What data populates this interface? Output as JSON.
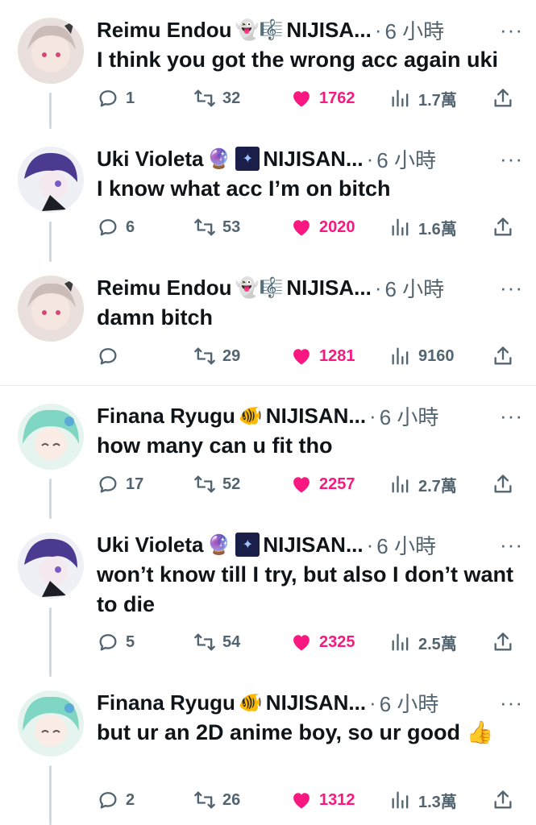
{
  "tweets": [
    {
      "name": "Reimu Endou",
      "badge": "👻🎼",
      "group": "NIJISA...",
      "dot": "·",
      "time": "6 小時",
      "text": "I think you got the wrong acc again uki",
      "replies": "1",
      "retweets": "32",
      "likes": "1762",
      "views": "1.7萬",
      "avatar_color": "#d8c8c4"
    },
    {
      "name": "Uki Violeta",
      "badge": "🔮",
      "group": "NIJISAN...",
      "dot": "·",
      "time": "6 小時",
      "text": "I know what acc I’m on bitch",
      "replies": "6",
      "retweets": "53",
      "likes": "2020",
      "views": "1.6萬",
      "avatar_color": "#5a3c8a"
    },
    {
      "name": "Reimu Endou",
      "badge": "👻🎼",
      "group": "NIJISA...",
      "dot": "·",
      "time": "6 小時",
      "text": "damn bitch",
      "replies": "",
      "retweets": "29",
      "likes": "1281",
      "views": "9160",
      "avatar_color": "#d8c8c4"
    },
    {
      "name": "Finana Ryugu",
      "badge": "🐠",
      "group": "NIJISAN...",
      "dot": "·",
      "time": "6 小時",
      "text": "how many can u fit tho",
      "replies": "17",
      "retweets": "52",
      "likes": "2257",
      "views": "2.7萬",
      "avatar_color": "#7dd3c0"
    },
    {
      "name": "Uki Violeta",
      "badge": "🔮",
      "group": "NIJISAN...",
      "dot": "·",
      "time": "6 小時",
      "text": "won’t know till I try, but also I don’t want to die",
      "replies": "5",
      "retweets": "54",
      "likes": "2325",
      "views": "2.5萬",
      "avatar_color": "#5a3c8a"
    },
    {
      "name": "Finana Ryugu",
      "badge": "🐠",
      "group": "NIJISAN...",
      "dot": "·",
      "time": "6 小時",
      "text": "but ur an 2D anime boy, so ur good 👍",
      "replies": "2",
      "retweets": "26",
      "likes": "1312",
      "views": "1.3萬",
      "avatar_color": "#7dd3c0"
    }
  ],
  "more_label": "···",
  "colors": {
    "like": "#f91880",
    "muted": "#536471",
    "text": "#0f1419",
    "thread_line": "#cfd9de"
  }
}
